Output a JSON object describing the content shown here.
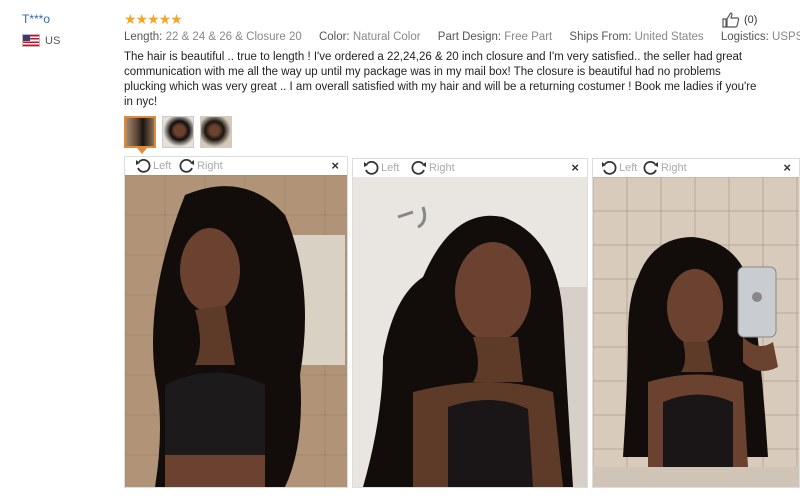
{
  "user": {
    "name": "T***o",
    "country": "US"
  },
  "rating": {
    "stars": "★★★★★",
    "value": 5
  },
  "helpful": {
    "count": "(0)"
  },
  "details": [
    {
      "label": "Length:",
      "value": "22 & 24 & 26 & Closure 20"
    },
    {
      "label": "Color:",
      "value": "Natural Color"
    },
    {
      "label": "Part Design:",
      "value": "Free Part"
    },
    {
      "label": "Ships From:",
      "value": "United States"
    },
    {
      "label": "Logistics:",
      "value": "USPS"
    }
  ],
  "review_text": "The hair is beautiful .. true to length ! I've ordered a 22,24,26 & 20 inch closure and I'm very satisfied.. the seller had great communication with me all the way up until my package was in my mail box! The closure is beautiful had no problems plucking which was very great .. I am overall satisfied with my hair and will be a returning costumer ! Book me ladies if you're in nyc!",
  "viewer": {
    "left_label": "Left",
    "right_label": "Right",
    "close_label": "×"
  },
  "colors": {
    "accent": "#e08a3c",
    "star": "#f6a623",
    "link": "#2a6ab0"
  }
}
